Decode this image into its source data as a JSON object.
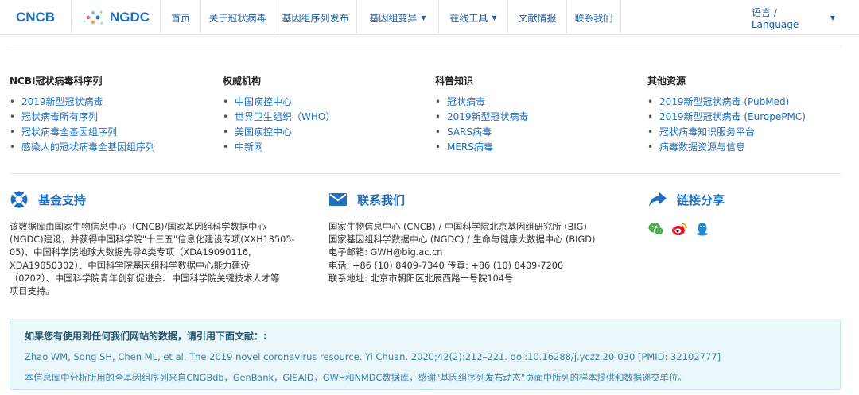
{
  "header": {
    "logo_cncb": "CNCB",
    "logo_ngdc": "NGDC",
    "nav": [
      {
        "label": "首页"
      },
      {
        "label": "关于冠状病毒"
      },
      {
        "label": "基因组序列发布"
      },
      {
        "label": "基因组变异"
      },
      {
        "label": "在线工具"
      },
      {
        "label": "文献情报"
      },
      {
        "label": "联系我们"
      }
    ],
    "language": "语言 / Language"
  },
  "columns": [
    {
      "title": "NCBI冠状病毒科序列",
      "items": [
        "2019新型冠状病毒",
        "冠状病毒所有序列",
        "冠状病毒全基因组序列",
        "感染人的冠状病毒全基因组序列"
      ]
    },
    {
      "title": "权威机构",
      "items": [
        "中国疾控中心",
        "世界卫生组织（WHO）",
        "美国疾控中心",
        "中新网"
      ]
    },
    {
      "title": "科普知识",
      "items": [
        "冠状病毒",
        "2019新型冠状病毒",
        "SARS病毒",
        "MERS病毒"
      ]
    },
    {
      "title": "其他资源",
      "items": [
        "2019新型冠状病毒 (PubMed)",
        "2019新型冠状病毒 (EuropePMC)",
        "冠状病毒知识服务平台",
        "病毒数据资源与信息"
      ]
    }
  ],
  "funding": {
    "title": "基金支持",
    "lines": [
      "该数据库由国家生物信息中心（CNCB)/国家基因组科学数据中心",
      "(NGDC)建设，并获得中国科学院\"十三五\"信息化建设专项(XXH13505-",
      "05)、中国科学院地球大数据先导A类专项（XDA19090116,",
      "XDA19050302）、中国科学院基因组科学数据中心能力建设",
      "（0202）、中国科学院青年创新促进会、中国科学院关键技术人才等",
      "项目支持。"
    ]
  },
  "contact": {
    "title": "联系我们",
    "lines": [
      "国家生物信息中心 (CNCB) / 中国科学院北京基因组研究所 (BIG)",
      "国家基因组科学数据中心 (NGDC) / 生命与健康大数据中心 (BIGD)",
      "电子邮箱: GWH@big.ac.cn",
      "电话: +86 (10) 8409-7340 传真: +86 (10) 8409-7200",
      "联系地址: 北京市朝阳区北辰西路一号院104号"
    ]
  },
  "share": {
    "title": "链接分享",
    "icons": [
      "wechat-icon",
      "weibo-icon",
      "qq-icon"
    ]
  },
  "citation": {
    "title": "如果您有使用到任何我们网站的数据，请引用下面文献：:",
    "reference": "Zhao WM, Song SH, Chen ML, et al. The 2019 novel coronavirus resource. Yi Chuan. 2020;42(2):212–221. doi:10.16288/j.yczz.20-030 [PMID: 32102777]",
    "note": "本信息库中分析所用的全基因组序列来自CNGBdb，GenBank，GISAID，GWH和NMDC数据库，感谢\"基因组序列发布动态\"页面中所列的样本提供和数据递交单位。"
  },
  "colors": {
    "brand": "#1f6fbf",
    "nav_text": "#1f5e9e",
    "cite_bg": "#e9f6fa",
    "social_green": "#4caf50",
    "social_red": "#e6162d",
    "social_blue": "#1f8ad2"
  }
}
